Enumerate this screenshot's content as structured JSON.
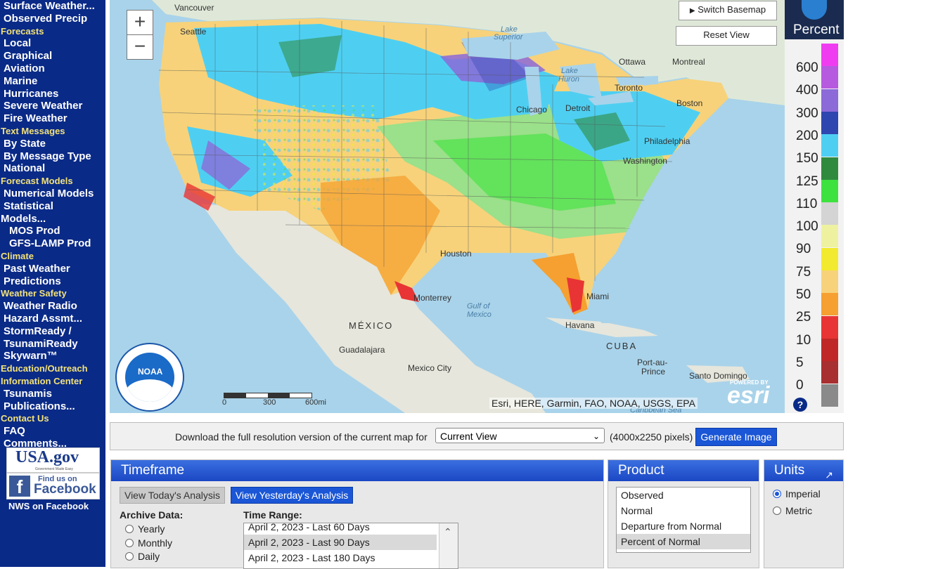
{
  "sidebar": {
    "items": [
      {
        "label": "Surface Weather...",
        "kind": "item"
      },
      {
        "label": "Observed Precip",
        "kind": "item"
      },
      {
        "label": "Forecasts",
        "kind": "head"
      },
      {
        "label": "Local",
        "kind": "item"
      },
      {
        "label": "Graphical",
        "kind": "item"
      },
      {
        "label": "Aviation",
        "kind": "item"
      },
      {
        "label": "Marine",
        "kind": "item"
      },
      {
        "label": "Hurricanes",
        "kind": "item"
      },
      {
        "label": "Severe Weather",
        "kind": "item"
      },
      {
        "label": "Fire Weather",
        "kind": "item"
      },
      {
        "label": "Text Messages",
        "kind": "head"
      },
      {
        "label": "By State",
        "kind": "item"
      },
      {
        "label": "By Message Type",
        "kind": "item"
      },
      {
        "label": "National",
        "kind": "item"
      },
      {
        "label": "Forecast Models",
        "kind": "head"
      },
      {
        "label": "Numerical Models",
        "kind": "item"
      },
      {
        "label": "Statistical",
        "kind": "item"
      },
      {
        "label": "Models...",
        "kind": "item-flush"
      },
      {
        "label": "MOS Prod",
        "kind": "sub"
      },
      {
        "label": "GFS-LAMP Prod",
        "kind": "sub"
      },
      {
        "label": "Climate",
        "kind": "head"
      },
      {
        "label": "Past Weather",
        "kind": "item"
      },
      {
        "label": "Predictions",
        "kind": "item"
      },
      {
        "label": "Weather Safety",
        "kind": "head"
      },
      {
        "label": "Weather Radio",
        "kind": "item"
      },
      {
        "label": "Hazard Assmt...",
        "kind": "item"
      },
      {
        "label": "StormReady /",
        "kind": "item"
      },
      {
        "label": "TsunamiReady",
        "kind": "item"
      },
      {
        "label": "Skywarn™",
        "kind": "item"
      },
      {
        "label": "Education/Outreach",
        "kind": "head"
      },
      {
        "label": "Information Center",
        "kind": "head"
      },
      {
        "label": "Tsunamis",
        "kind": "item"
      },
      {
        "label": "Publications...",
        "kind": "item"
      },
      {
        "label": "Contact Us",
        "kind": "head"
      },
      {
        "label": "FAQ",
        "kind": "item"
      },
      {
        "label": "Comments...",
        "kind": "item"
      }
    ],
    "usagov": "USA.gov",
    "usagov_sub": "Government Made Easy",
    "facebook_find": "Find us on",
    "facebook_name": "Facebook",
    "nws_facebook": "NWS on Facebook"
  },
  "map": {
    "zoom_in": "+",
    "zoom_out": "−",
    "switch_basemap": "Switch Basemap",
    "reset_view": "Reset View",
    "labels": {
      "vancouver": "Vancouver",
      "seattle": "Seattle",
      "lake_superior_1": "Lake",
      "lake_superior_2": "Superior",
      "ottawa": "Ottawa",
      "montreal": "Montreal",
      "lake_huron_1": "Lake",
      "lake_huron_2": "Huron",
      "toronto": "Toronto",
      "chicago": "Chicago",
      "detroit": "Detroit",
      "boston": "Boston",
      "philadelphia": "Philadelphia",
      "washington": "Washington",
      "houston": "Houston",
      "monterrey": "Monterrey",
      "gulf_1": "Gulf of",
      "gulf_2": "Mexico",
      "miami": "Miami",
      "havana": "Havana",
      "mexico": "MÉXICO",
      "cuba": "CUBA",
      "guadalajara": "Guadalajara",
      "mexico_city": "Mexico City",
      "port_au_prince_1": "Port-au-",
      "port_au_prince_2": "Prince",
      "santo_domingo": "Santo Domingo",
      "caribbean": "Caribbean Sea"
    },
    "scale": [
      "0",
      "300",
      "600mi"
    ],
    "noaa": "NOAA",
    "attribution": "Esri, HERE, Garmin, FAO, NOAA, USGS, EPA",
    "esri_powered": "POWERED BY",
    "esri": "esri"
  },
  "legend": {
    "unit": "Percent",
    "help": "?",
    "entries": [
      {
        "label": "600",
        "color": "#f03cf0"
      },
      {
        "label": "400",
        "color": "#b65ae0"
      },
      {
        "label": "300",
        "color": "#8c6ad8"
      },
      {
        "label": "200",
        "color": "#2e46b0"
      },
      {
        "label": "150",
        "color": "#4ecff2"
      },
      {
        "label": "125",
        "color": "#2f8a3e"
      },
      {
        "label": "110",
        "color": "#3ee23e"
      },
      {
        "label": "100",
        "color": "#d4d4d4"
      },
      {
        "label": "90",
        "color": "#eef2a0"
      },
      {
        "label": "75",
        "color": "#f2ea2e"
      },
      {
        "label": "50",
        "color": "#f7d27a"
      },
      {
        "label": "25",
        "color": "#f5a030"
      },
      {
        "label": "10",
        "color": "#e83434"
      },
      {
        "label": "5",
        "color": "#c02828"
      },
      {
        "label": "0",
        "color": "#a83030"
      },
      {
        "label": "",
        "color": "#8a8a8a"
      }
    ]
  },
  "download": {
    "text": "Download the full resolution version of the current map for",
    "select_value": "Current View",
    "pixels": "(4000x2250 pixels)",
    "generate": "Generate Image"
  },
  "timeframe": {
    "title": "Timeframe",
    "today_btn": "View Today's Analysis",
    "yesterday_btn": "View Yesterday's Analysis",
    "archive_label": "Archive Data:",
    "archive_options": [
      "Yearly",
      "Monthly",
      "Daily"
    ],
    "range_label": "Time Range:",
    "range_items": [
      "April 2, 2023 - Last 60 Days",
      "April 2, 2023 - Last 90 Days",
      "April 2, 2023 - Last 180 Days"
    ],
    "range_selected": 1
  },
  "product": {
    "title": "Product",
    "items": [
      "Observed",
      "Normal",
      "Departure from Normal",
      "Percent of Normal"
    ],
    "selected": 3
  },
  "units": {
    "title": "Units",
    "options": [
      "Imperial",
      "Metric"
    ],
    "selected": 0
  }
}
